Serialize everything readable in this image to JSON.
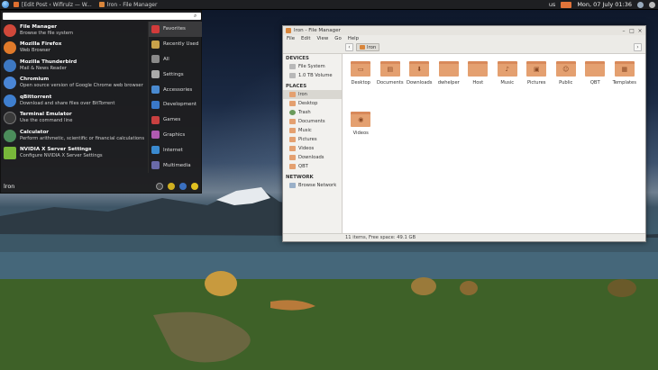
{
  "taskbar": {
    "tasks": [
      {
        "label": "[Edit Post ‹ Wifirulz — W...",
        "color": "#e07030"
      },
      {
        "label": "lron - File Manager",
        "color": "#d8853b"
      }
    ],
    "keyboard": "us",
    "clock": "Mon, 07 July 01:36"
  },
  "start_menu": {
    "search_placeholder": "",
    "apps": [
      {
        "name": "File Manager",
        "desc": "Browse the file system",
        "color": "#d0483a"
      },
      {
        "name": "Mozilla Firefox",
        "desc": "Web Browser",
        "color": "#e07a2a"
      },
      {
        "name": "Mozilla Thunderbird",
        "desc": "Mail & News Reader",
        "color": "#3d78c2"
      },
      {
        "name": "Chromium",
        "desc": "Open source version of Google Chrome web browser",
        "color": "#4a86d6"
      },
      {
        "name": "qBittorrent",
        "desc": "Download and share files over BitTorrent",
        "color": "#3f7fcf"
      },
      {
        "name": "Terminal Emulator",
        "desc": "Use the command line",
        "color": "#3a3a3a"
      },
      {
        "name": "Calculator",
        "desc": "Perform arithmetic, scientific or financial calculations",
        "color": "#4b8d5b"
      },
      {
        "name": "NVIDIA X Server Settings",
        "desc": "Configure NVIDIA X Server Settings",
        "color": "#78b83a"
      }
    ],
    "categories": [
      {
        "label": "Favorites",
        "color": "#d23b3b"
      },
      {
        "label": "Recently Used",
        "color": "#c9a24a"
      },
      {
        "label": "All",
        "color": "#8a8a8a"
      },
      {
        "label": "Settings",
        "color": "#aaaaaa"
      },
      {
        "label": "Accessories",
        "color": "#4a8ad0"
      },
      {
        "label": "Development",
        "color": "#3a78c8"
      },
      {
        "label": "Games",
        "color": "#c84040"
      },
      {
        "label": "Graphics",
        "color": "#b05ab0"
      },
      {
        "label": "Internet",
        "color": "#3a8ad0"
      },
      {
        "label": "Multimedia",
        "color": "#6a6aa8"
      }
    ],
    "user": "lron"
  },
  "file_manager": {
    "title": "lron - File Manager",
    "menu": [
      "File",
      "Edit",
      "View",
      "Go",
      "Help"
    ],
    "breadcrumb": "lron",
    "sidebar": {
      "devices_heading": "DEVICES",
      "devices": [
        "File System",
        "1.0 TB Volume"
      ],
      "places_heading": "PLACES",
      "places": [
        "lron",
        "Desktop",
        "Trash",
        "Documents",
        "Music",
        "Pictures",
        "Videos",
        "Downloads",
        "QBT"
      ],
      "network_heading": "NETWORK",
      "network": [
        "Browse Network"
      ]
    },
    "files": [
      {
        "name": "Desktop",
        "glyph": "▭"
      },
      {
        "name": "Documents",
        "glyph": "▤"
      },
      {
        "name": "Downloads",
        "glyph": "⬇"
      },
      {
        "name": "dwhelper",
        "glyph": ""
      },
      {
        "name": "Host",
        "glyph": ""
      },
      {
        "name": "Music",
        "glyph": "♪"
      },
      {
        "name": "Pictures",
        "glyph": "▣"
      },
      {
        "name": "Public",
        "glyph": "☺"
      },
      {
        "name": "QBT",
        "glyph": ""
      },
      {
        "name": "Templates",
        "glyph": "▦"
      },
      {
        "name": "Videos",
        "glyph": "◉"
      }
    ],
    "status": "11 items, Free space: 49.1 GB"
  }
}
